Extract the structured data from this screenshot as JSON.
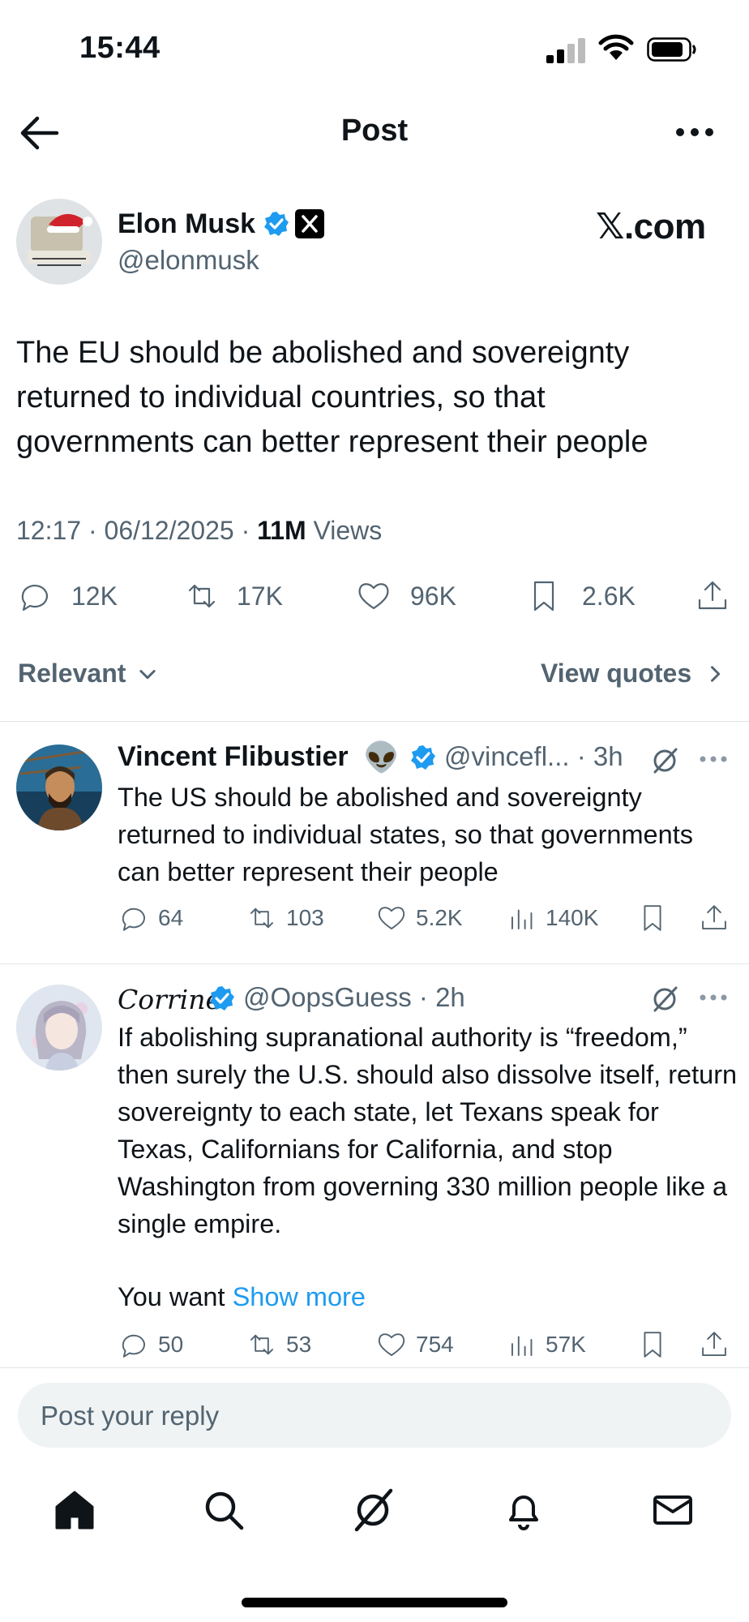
{
  "status_bar": {
    "time": "15:44"
  },
  "header": {
    "title": "Post"
  },
  "post": {
    "author_name": "Elon Musk",
    "author_handle": "@elonmusk",
    "source_label": "𝕏.com",
    "text": "The EU should be abolished and sovereignty returned to individual countries, so that governments can better represent their people",
    "time": "12:17 · 06/12/2025 · ",
    "views_count": "11M",
    "views_label": " Views",
    "replies": "12K",
    "reposts": "17K",
    "likes": "96K",
    "bookmarks": "2.6K"
  },
  "filters": {
    "sort_label": "Relevant",
    "view_quotes_label": "View quotes"
  },
  "replies": [
    {
      "name": "Vincent Flibustier",
      "emoji": "👽",
      "handle": "@vincefl... · 3h",
      "text": "The US should be abolished and sovereignty returned to individual states, so that governments can better represent their people",
      "replies": "64",
      "reposts": "103",
      "likes": "5.2K",
      "views": "140K"
    },
    {
      "name": "Corrine",
      "handle": "@OopsGuess · 2h",
      "text": "If abolishing supranational authority is “freedom,” then surely the U.S. should also dissolve itself, return sovereignty to each state, let Texans speak for Texas, Californians for California, and stop Washington from governing 330 million people like a single empire.",
      "text_tail": "You want ",
      "show_more": "Show more",
      "replies": "50",
      "reposts": "53",
      "likes": "754",
      "views": "57K"
    }
  ],
  "reply_input": {
    "placeholder": "Post your reply"
  },
  "colors": {
    "accent": "#1d9bf0",
    "secondary_text": "#536471",
    "primary_text": "#0f1419"
  }
}
